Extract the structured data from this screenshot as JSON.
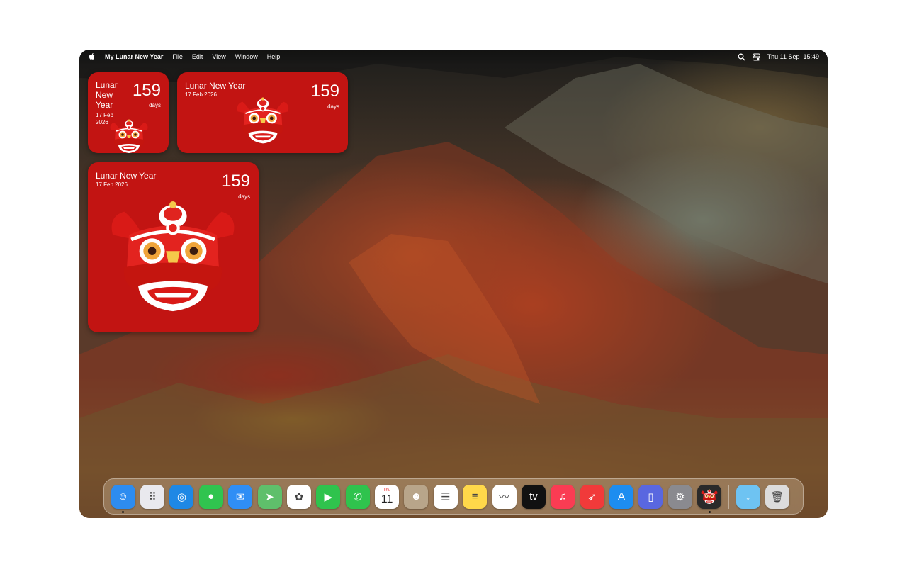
{
  "menubar": {
    "app_name": "My Lunar New Year",
    "menus": [
      "File",
      "Edit",
      "View",
      "Window",
      "Help"
    ],
    "clock": "Thu 11 Sep  15:49"
  },
  "widgets": {
    "small": {
      "title": "Lunar\nNew\nYear",
      "date": "17 Feb\n2026",
      "count": "159",
      "unit": "days"
    },
    "medium": {
      "title": "Lunar New Year",
      "date": "17 Feb 2026",
      "count": "159",
      "unit": "days"
    },
    "large": {
      "title": "Lunar New Year",
      "date": "17 Feb 2026",
      "count": "159",
      "unit": "days"
    }
  },
  "calendar_icon": {
    "weekday": "Thu",
    "day": "11"
  },
  "dock": {
    "apps": [
      {
        "name": "finder-icon",
        "color": "#2d8cf0"
      },
      {
        "name": "launchpad-icon",
        "color": "#e9e9ee"
      },
      {
        "name": "safari-icon",
        "color": "#1e88e5"
      },
      {
        "name": "messages-icon",
        "color": "#30c44f"
      },
      {
        "name": "mail-icon",
        "color": "#2f8ef5"
      },
      {
        "name": "maps-icon",
        "color": "#5fbf6b"
      },
      {
        "name": "photos-icon",
        "color": "#ffffff"
      },
      {
        "name": "facetime-icon",
        "color": "#2fc34d"
      },
      {
        "name": "phone-icon",
        "color": "#2fc34d"
      },
      {
        "name": "calendar-icon",
        "color": "#ffffff"
      },
      {
        "name": "contacts-icon",
        "color": "#b8a58a"
      },
      {
        "name": "reminders-icon",
        "color": "#ffffff"
      },
      {
        "name": "notes-icon",
        "color": "#ffd84a"
      },
      {
        "name": "freeform-icon",
        "color": "#ffffff"
      },
      {
        "name": "tv-icon",
        "color": "#111111"
      },
      {
        "name": "music-icon",
        "color": "#fa3c53"
      },
      {
        "name": "rocketsim-icon",
        "color": "#f13a3a"
      },
      {
        "name": "app-store-icon",
        "color": "#1d8df0"
      },
      {
        "name": "simulator-icon",
        "color": "#5967e0"
      },
      {
        "name": "system-settings-icon",
        "color": "#8a8a8f"
      },
      {
        "name": "lunar-new-year-app-icon",
        "color": "#2a2a2a"
      }
    ],
    "extras": [
      {
        "name": "downloads-folder-icon",
        "color": "#6ec3f2"
      },
      {
        "name": "trash-icon",
        "color": "#dcdcdc"
      }
    ]
  }
}
